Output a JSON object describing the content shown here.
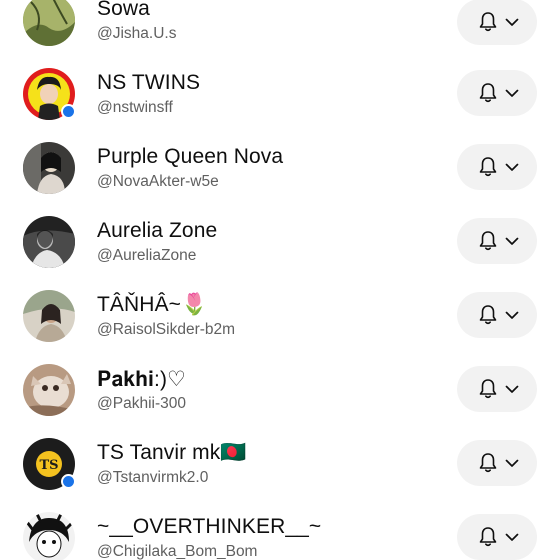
{
  "channels": [
    {
      "name": "Sowa",
      "handle": "@Jisha.U.s",
      "verified": false,
      "avatar_icon": "avatar-sowa",
      "bell_icon": "bell-icon",
      "chevron_icon": "chevron-down-icon"
    },
    {
      "name": "NS TWINS",
      "handle": "@nstwinsff",
      "verified": true,
      "avatar_icon": "avatar-ns-twins",
      "bell_icon": "bell-icon",
      "chevron_icon": "chevron-down-icon"
    },
    {
      "name": "Purple Queen Nova",
      "handle": "@NovaAkter-w5e",
      "verified": false,
      "avatar_icon": "avatar-purple-queen-nova",
      "bell_icon": "bell-icon",
      "chevron_icon": "chevron-down-icon"
    },
    {
      "name": "Aurelia Zone",
      "handle": "@AureliaZone",
      "verified": false,
      "avatar_icon": "avatar-aurelia-zone",
      "bell_icon": "bell-icon",
      "chevron_icon": "chevron-down-icon"
    },
    {
      "name": "TÂŇHÂ~🌷",
      "handle": "@RaisolSikder-b2m",
      "verified": false,
      "avatar_icon": "avatar-tanha",
      "bell_icon": "bell-icon",
      "chevron_icon": "chevron-down-icon"
    },
    {
      "name": "𝐏𝐚𝐤𝐡𝐢:)♡",
      "handle": "@Pakhii-300",
      "verified": false,
      "avatar_icon": "avatar-pakhi",
      "bell_icon": "bell-icon",
      "chevron_icon": "chevron-down-icon"
    },
    {
      "name": "TS Tanvir mk🇧🇩",
      "handle": "@Tstanvirmk2.0",
      "verified": true,
      "avatar_icon": "avatar-ts-tanvir",
      "bell_icon": "bell-icon",
      "chevron_icon": "chevron-down-icon"
    },
    {
      "name": "~__OVERTHINKER__~",
      "handle": "@Chigilaka_Bom_Bom",
      "verified": false,
      "avatar_icon": "avatar-overthinker",
      "bell_icon": "bell-icon",
      "chevron_icon": "chevron-down-icon"
    }
  ],
  "colors": {
    "name_text": "#0f0f0f",
    "handle_text": "#606060",
    "button_bg": "#f2f2f2",
    "verified_badge": "#1a73e8"
  }
}
